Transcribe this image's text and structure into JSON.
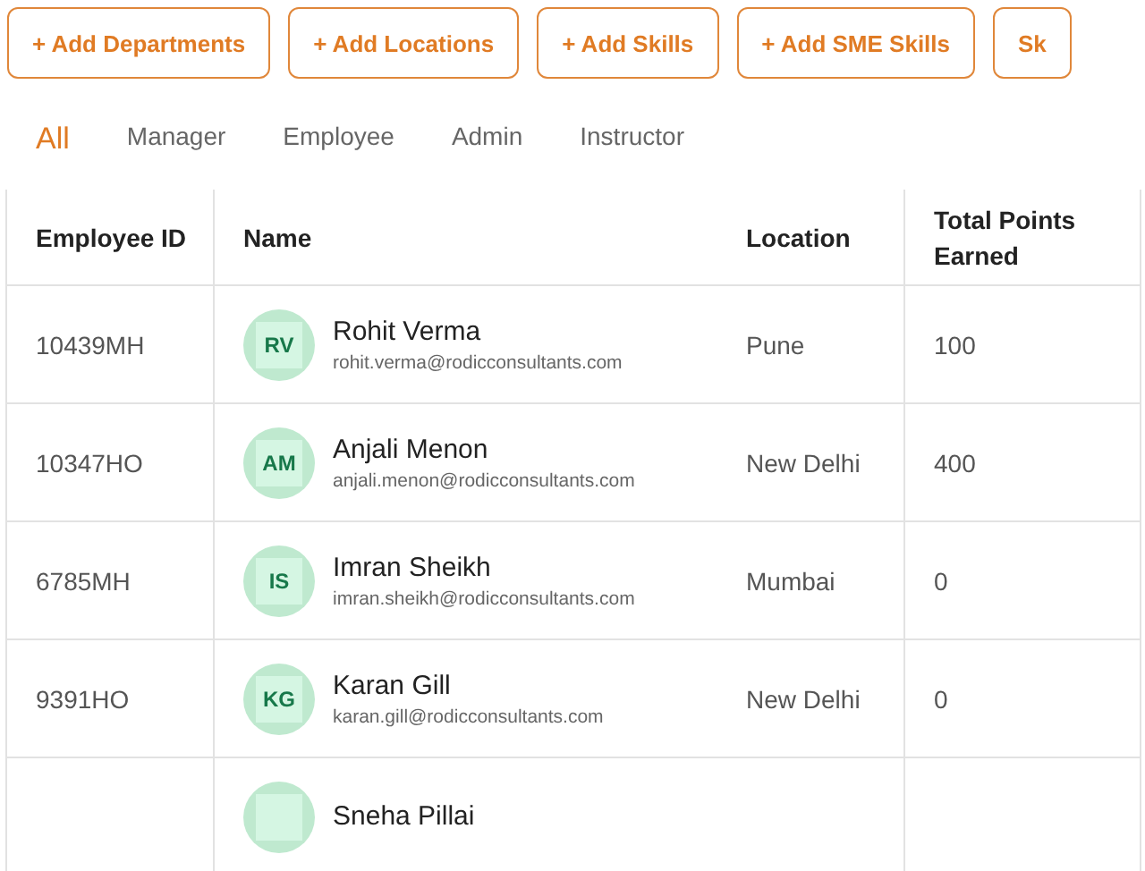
{
  "actions": [
    "+ Add Departments",
    "+ Add Locations",
    "+ Add Skills",
    "+ Add SME Skills",
    "Sk"
  ],
  "tabs": [
    {
      "label": "All",
      "selected": true
    },
    {
      "label": "Manager",
      "selected": false
    },
    {
      "label": "Employee",
      "selected": false
    },
    {
      "label": "Admin",
      "selected": false
    },
    {
      "label": "Instructor",
      "selected": false
    }
  ],
  "table": {
    "columns": [
      "Employee ID",
      "Name",
      "Location",
      "Total Points Earned"
    ],
    "rows": [
      {
        "id": "10439MH",
        "initials": "RV",
        "name": "Rohit Verma",
        "email": "rohit.verma@rodicconsultants.com",
        "location": "Pune",
        "points": "100"
      },
      {
        "id": "10347HO",
        "initials": "AM",
        "name": "Anjali Menon",
        "email": "anjali.menon@rodicconsultants.com",
        "location": "New Delhi",
        "points": "400"
      },
      {
        "id": "6785MH",
        "initials": "IS",
        "name": "Imran Sheikh",
        "email": "imran.sheikh@rodicconsultants.com",
        "location": "Mumbai",
        "points": "0"
      },
      {
        "id": "9391HO",
        "initials": "KG",
        "name": "Karan Gill",
        "email": "karan.gill@rodicconsultants.com",
        "location": "New Delhi",
        "points": "0"
      },
      {
        "name": "Sneha Pillai"
      }
    ]
  }
}
